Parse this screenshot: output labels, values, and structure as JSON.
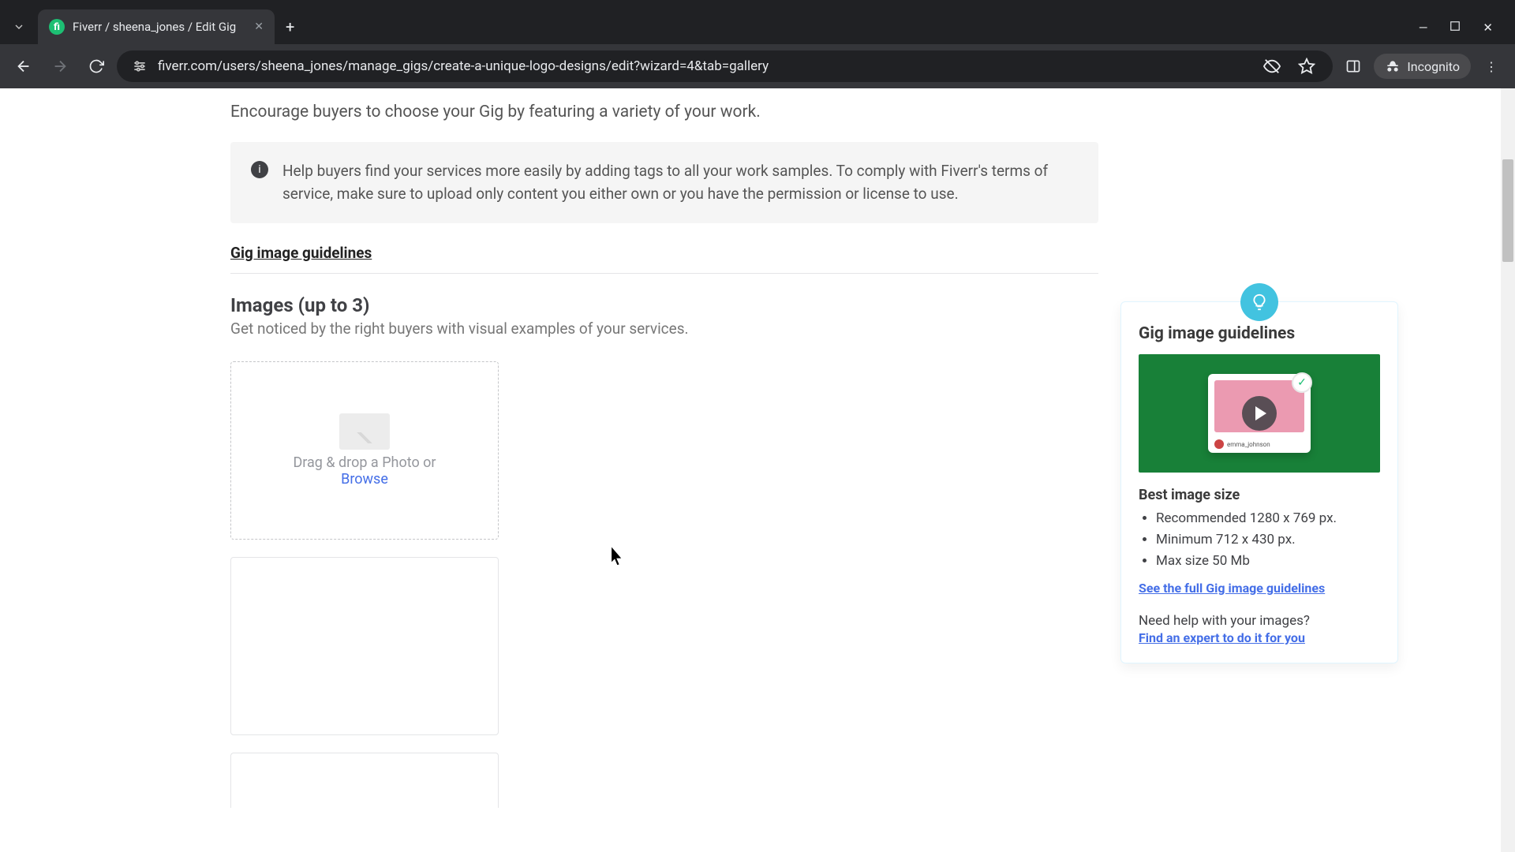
{
  "browser": {
    "tab_title": "Fiverr / sheena_jones / Edit Gig",
    "url": "fiverr.com/users/sheena_jones/manage_gigs/create-a-unique-logo-designs/edit?wizard=4&tab=gallery",
    "incognito_label": "Incognito"
  },
  "page": {
    "lead": "Encourage buyers to choose your Gig by featuring a variety of your work.",
    "notice": "Help buyers find your services more easily by adding tags to all your work samples. To comply with Fiverr's terms of service, make sure to upload only content you either own or you have the permission or license to use.",
    "guidelines_link": "Gig image guidelines",
    "images": {
      "title": "Images (up to 3)",
      "subtitle": "Get noticed by the right buyers with visual examples of your services.",
      "drop_text": "Drag & drop a Photo or",
      "browse": "Browse"
    }
  },
  "tip": {
    "title": "Gig image guidelines",
    "video_user": "emma_johnson",
    "size_title": "Best image size",
    "bullets": [
      "Recommended 1280 x 769 px.",
      "Minimum 712 x 430 px.",
      "Max size 50 Mb"
    ],
    "full_link": "See the full Gig image guidelines",
    "help_q": "Need help with your images?",
    "help_link": "Find an expert to do it for you"
  }
}
